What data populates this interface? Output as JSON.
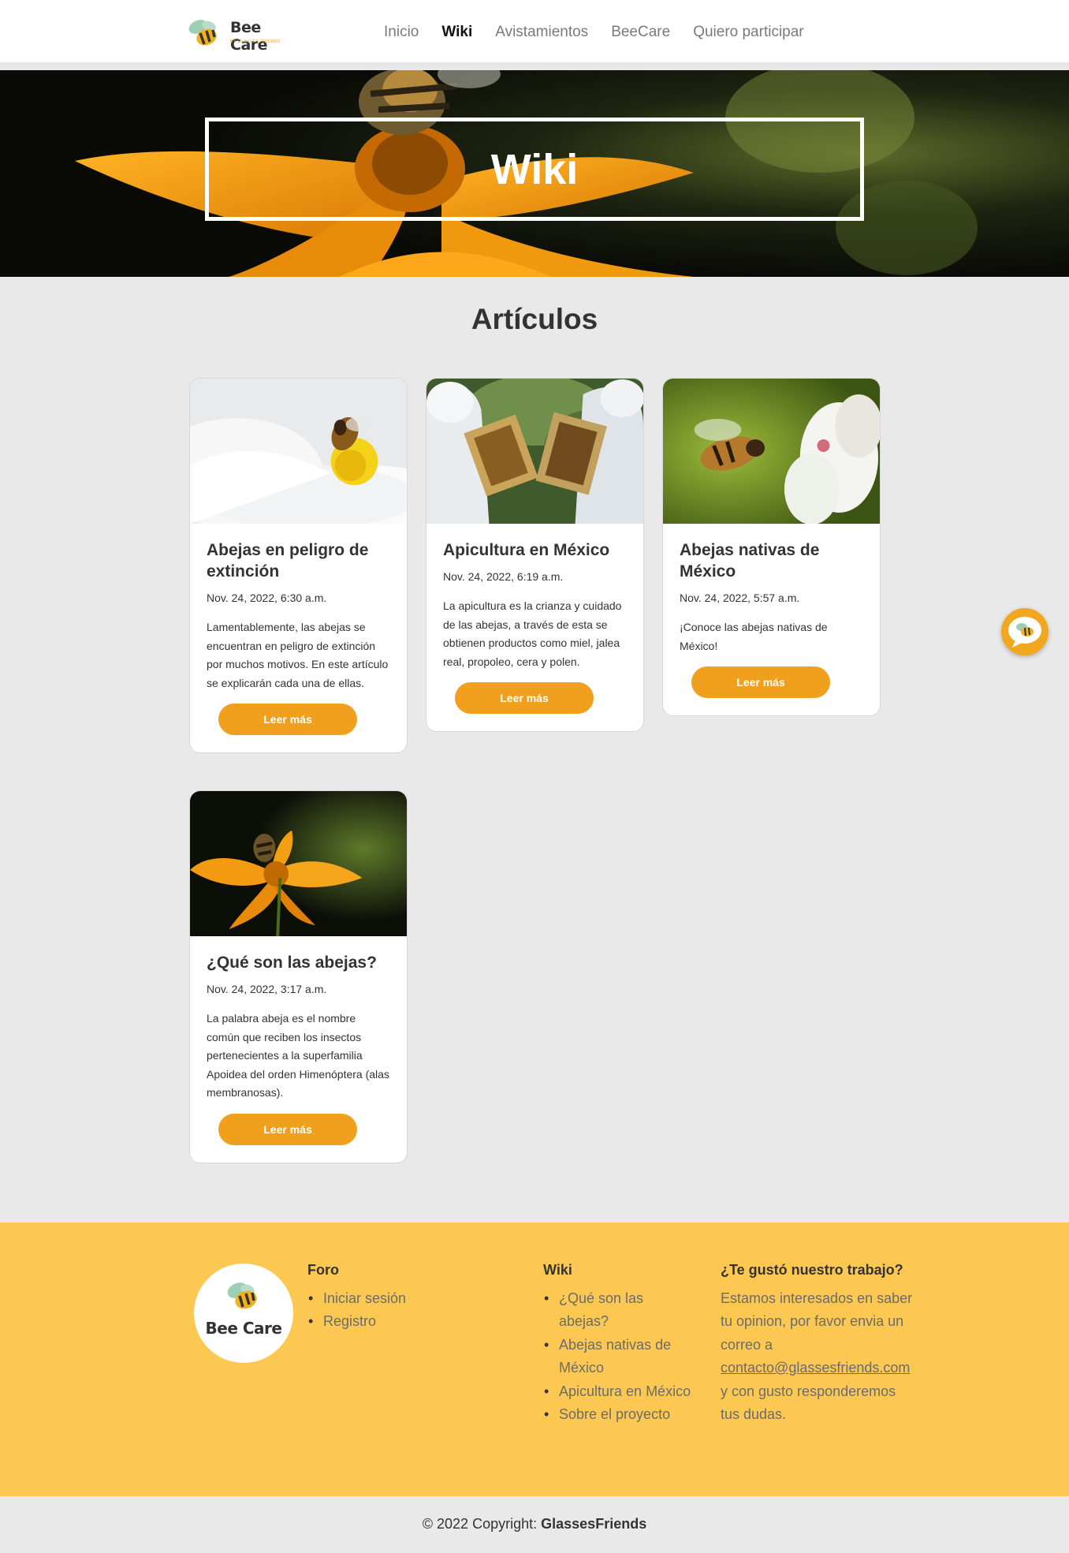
{
  "brand": {
    "name": "Bee Care",
    "subtitle": "BY GLASSES FRIENDS"
  },
  "nav": {
    "items": [
      {
        "label": "Inicio"
      },
      {
        "label": "Wiki"
      },
      {
        "label": "Avistamientos"
      },
      {
        "label": "BeeCare"
      },
      {
        "label": "Quiero participar"
      }
    ],
    "active": "Wiki"
  },
  "hero": {
    "title": "Wiki"
  },
  "section": {
    "title": "Artículos"
  },
  "cards": [
    {
      "title": "Abejas en peligro de extinción",
      "date": "Nov. 24, 2022, 6:30 a.m.",
      "text": "Lamentablemente, las abejas se encuentran en peligro de extinción por muchos motivos. En este artículo se explicarán cada una de ellas.",
      "button": "Leer más",
      "image": "bee-on-white-flower"
    },
    {
      "title": "Apicultura en México",
      "date": "Nov. 24, 2022, 6:19 a.m.",
      "text": "La apicultura es la crianza y cuidado de las abejas, a través de esta se obtienen productos como miel, jalea real, propoleo, cera y polen.",
      "button": "Leer más",
      "image": "beekeepers-with-frames"
    },
    {
      "title": "Abejas nativas de México",
      "date": "Nov. 24, 2022, 5:57 a.m.",
      "text": "¡Conoce las abejas nativas de México!",
      "button": "Leer más",
      "image": "bee-flying-to-blossom"
    },
    {
      "title": "¿Qué son las abejas?",
      "date": "Nov. 24, 2022, 3:17 a.m.",
      "text": "La palabra abeja es el nombre común que reciben los insectos pertenecientes a la superfamilia Apoidea del orden Himenóptera (alas membranosas).",
      "button": "Leer más",
      "image": "bee-on-orange-flower"
    }
  ],
  "footer": {
    "forum": {
      "title": "Foro",
      "links": [
        "Iniciar sesión",
        "Registro"
      ]
    },
    "wiki": {
      "title": "Wiki",
      "links": [
        "¿Qué son las abejas?",
        "Abejas nativas de México",
        "Apicultura en México",
        "Sobre el proyecto"
      ]
    },
    "contact": {
      "title": "¿Te gustó nuestro trabajo?",
      "text_before": "Estamos interesados en saber tu opinion, por favor envia un correo a",
      "email": "contacto@glassesfriends.com",
      "text_after": "y con gusto responderemos tus dudas."
    }
  },
  "copyright": {
    "prefix": "© 2022 Copyright:",
    "owner": "GlassesFriends"
  },
  "colors": {
    "accent": "#f0a01c",
    "footer_bg": "#fdc852",
    "page_bg": "#e9e9e9"
  }
}
